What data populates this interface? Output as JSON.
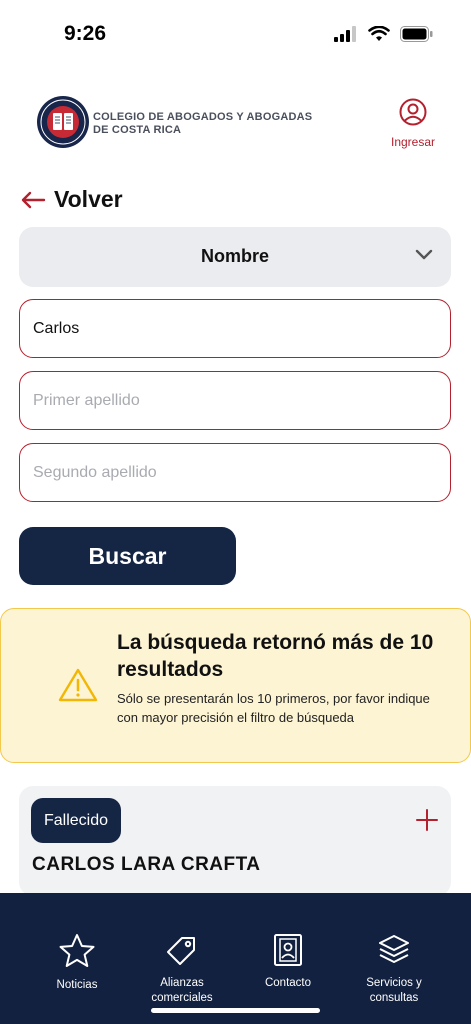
{
  "status_bar": {
    "time": "9:26"
  },
  "header": {
    "org_name_line1": "COLEGIO DE ABOGADOS Y ABOGADAS",
    "org_name_line2": "DE COSTA RICA",
    "login_label": "Ingresar"
  },
  "nav_back": {
    "label": "Volver"
  },
  "search_type": {
    "selected": "Nombre"
  },
  "form": {
    "first_name_value": "Carlos",
    "first_surname_placeholder": "Primer apellido",
    "second_surname_placeholder": "Segundo apellido",
    "search_button": "Buscar"
  },
  "alert": {
    "title": "La búsqueda retornó más de 10 resultados",
    "message": "Sólo se presentarán los 10 primeros, por favor indique con mayor precisión el filtro de búsqueda"
  },
  "result": {
    "badge": "Fallecido",
    "name": "CARLOS LARA CRAFTA"
  },
  "bottom_nav": {
    "items": [
      {
        "label": "Noticias",
        "icon": "star-icon"
      },
      {
        "label": "Alianzas comerciales",
        "icon": "tag-icon"
      },
      {
        "label": "Contacto",
        "icon": "contact-book-icon"
      },
      {
        "label": "Servicios y consultas",
        "icon": "layers-icon"
      }
    ]
  },
  "colors": {
    "brand_navy": "#152544",
    "accent_red": "#b3202e",
    "alert_bg": "#fdf4d4",
    "alert_border": "#f2c94c"
  }
}
